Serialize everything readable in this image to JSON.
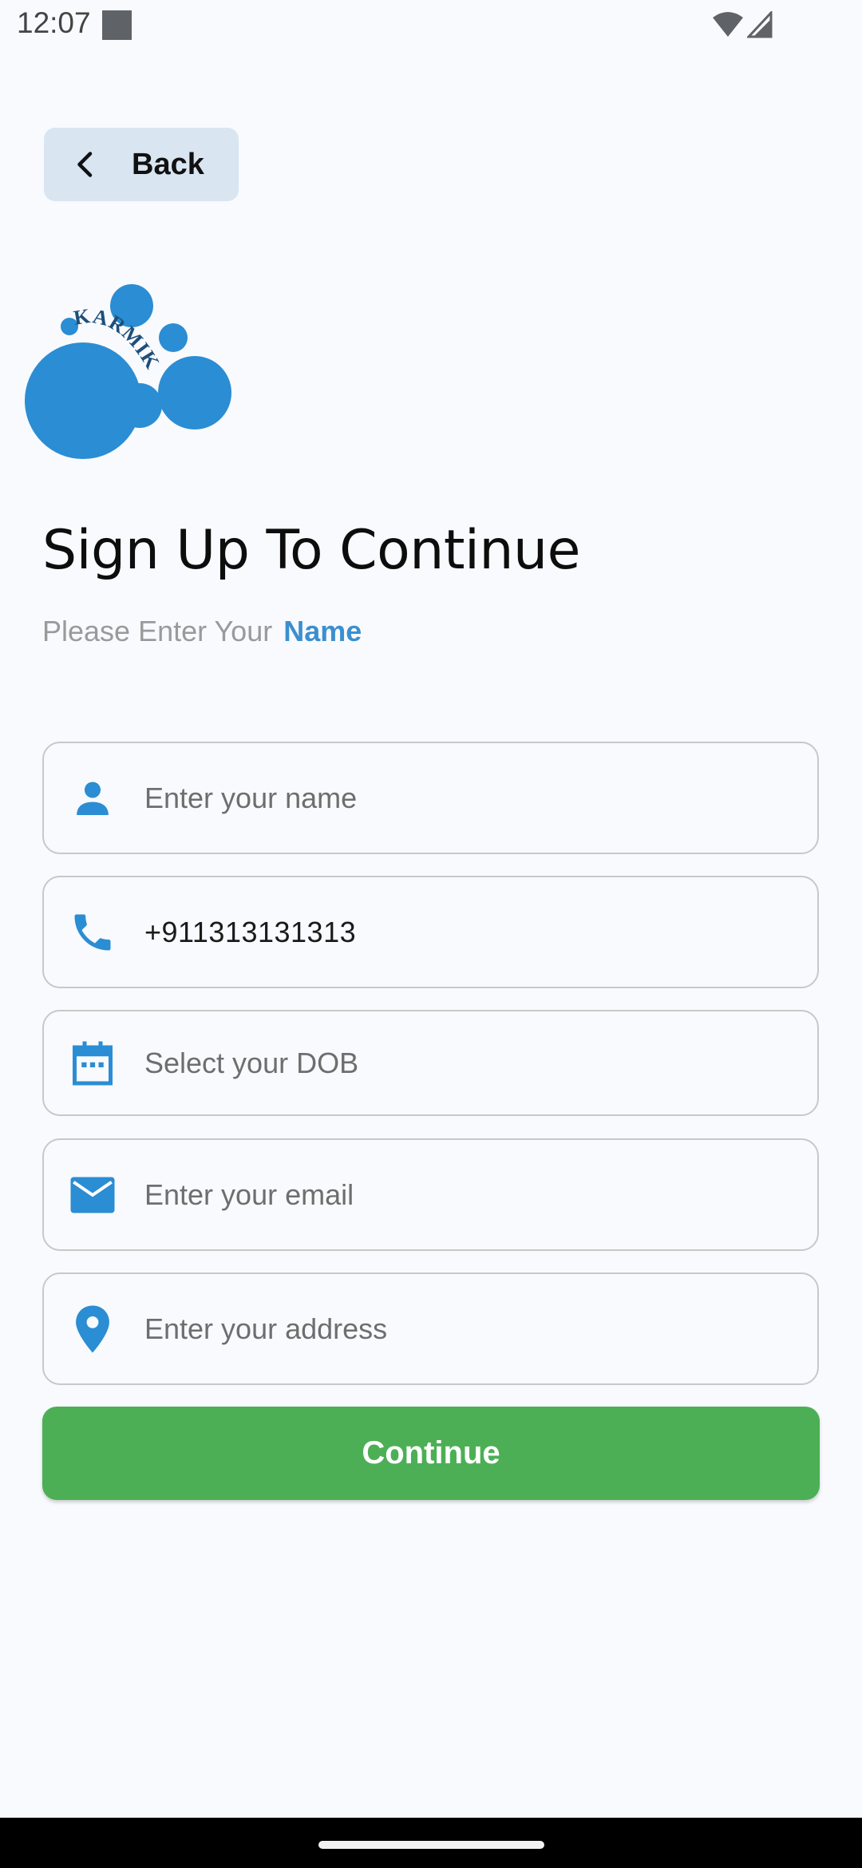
{
  "status_bar": {
    "time": "12:07"
  },
  "header": {
    "back_label": "Back"
  },
  "logo": {
    "text": "KARMIK",
    "color": "#2b8dd3"
  },
  "main": {
    "title": "Sign Up To Continue",
    "subtitle_prefix": "Please Enter Your",
    "subtitle_highlight": "Name"
  },
  "form": {
    "name_placeholder": "Enter your name",
    "phone_value": "+911313131313",
    "dob_placeholder": "Select your DOB",
    "email_placeholder": "Enter your email",
    "address_placeholder": "Enter your address"
  },
  "actions": {
    "continue_label": "Continue"
  },
  "colors": {
    "accent": "#2b8dd3",
    "button_green": "#4caf55",
    "background": "#f8fafd"
  },
  "icons": {
    "back": "chevron-left-icon",
    "name": "person-icon",
    "phone": "phone-icon",
    "dob": "calendar-icon",
    "email": "mail-icon",
    "address": "location-pin-icon"
  }
}
